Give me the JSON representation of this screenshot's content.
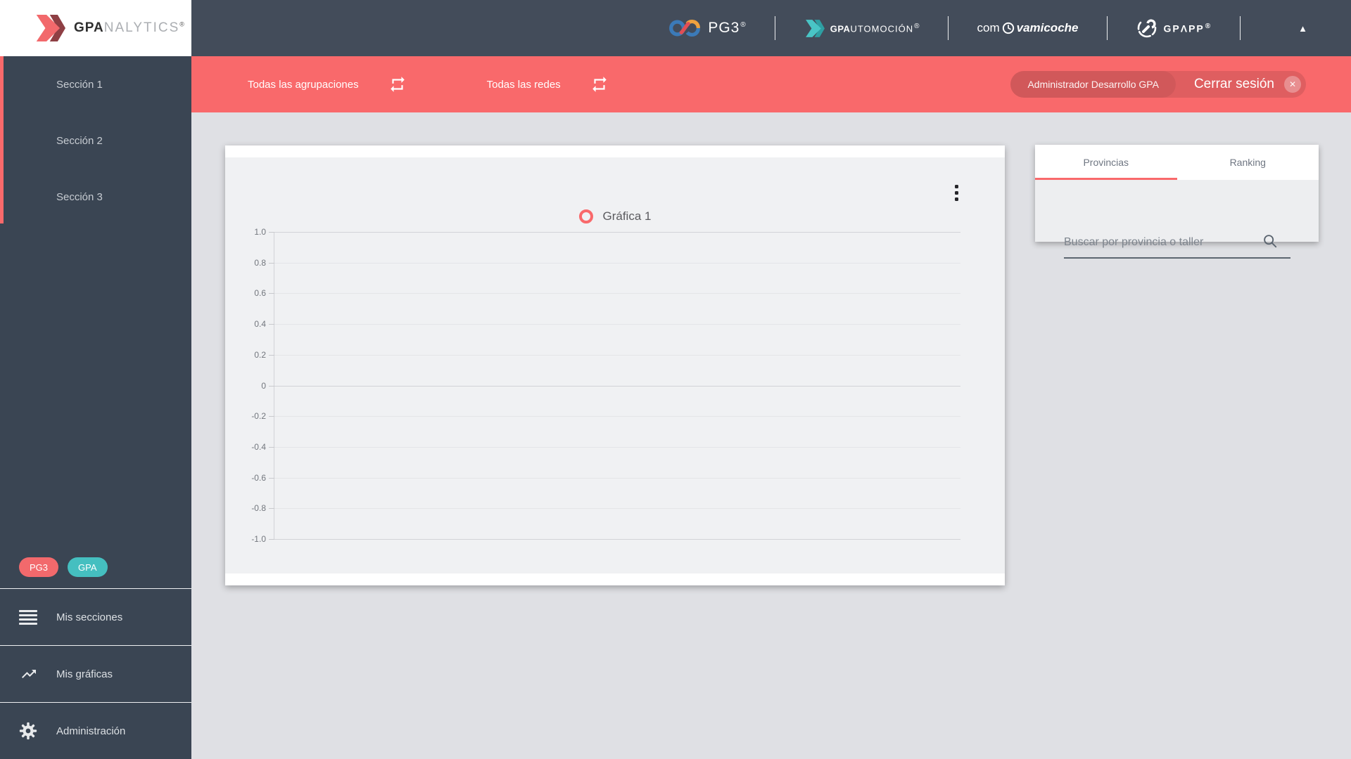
{
  "sidebar": {
    "logo": {
      "gpa": "GPA",
      "rest": "NALYTICS",
      "reg": "®"
    },
    "sections": [
      {
        "label": "Sección 1"
      },
      {
        "label": "Sección 2"
      },
      {
        "label": "Sección 3"
      }
    ],
    "badges": [
      {
        "label": "PG3",
        "color": "#F2696C"
      },
      {
        "label": "GPA",
        "color": "#45BFC0"
      }
    ],
    "menu": [
      {
        "label": "Mis secciones",
        "icon": "list-icon"
      },
      {
        "label": "Mis gráficas",
        "icon": "line-chart-icon"
      },
      {
        "label": "Administración",
        "icon": "gear-icon"
      }
    ]
  },
  "header": {
    "pg3": {
      "label": "PG3",
      "reg": "®"
    },
    "gpautomocion": {
      "gpa": "GPA",
      "rest": "UTOMOCIÓN",
      "reg": "®"
    },
    "comprobamicoche": {
      "pre": "com",
      "post": "vamicoche"
    },
    "gpapp": {
      "label": "GPΛPP",
      "reg": "®"
    },
    "collapse_icon": "▲"
  },
  "filterbar": {
    "groupings": "Todas las agrupaciones",
    "networks": "Todas las redes",
    "user": "Administrador Desarrollo GPA",
    "logout": "Cerrar sesión",
    "close_icon": "✕"
  },
  "chart_card": {
    "legend": "Gráfica 1"
  },
  "chart_data": {
    "type": "line",
    "title": "Gráfica 1",
    "series": [
      {
        "name": "Gráfica 1",
        "values": []
      }
    ],
    "categories": [],
    "ylim": [
      -1.0,
      1.0
    ],
    "ytick_labels": [
      "1.0",
      "0.8",
      "0.6",
      "0.4",
      "0.2",
      "0",
      "-0.2",
      "-0.4",
      "-0.6",
      "-0.8",
      "-1.0"
    ],
    "grid": true,
    "legend_position": "top-center",
    "note": "empty plot area — no data points rendered"
  },
  "right_panel": {
    "tabs": [
      {
        "label": "Provincias",
        "active": true
      },
      {
        "label": "Ranking",
        "active": false
      }
    ],
    "search_placeholder": "Buscar por provincia o taller"
  },
  "colors": {
    "accent_coral": "#F9696B",
    "sidebar_dark": "#3A4553",
    "header_dark": "#434C5A",
    "teal": "#45BFC0",
    "page_bg": "#DFE0E4",
    "plot_bg": "#F0F1F3"
  }
}
